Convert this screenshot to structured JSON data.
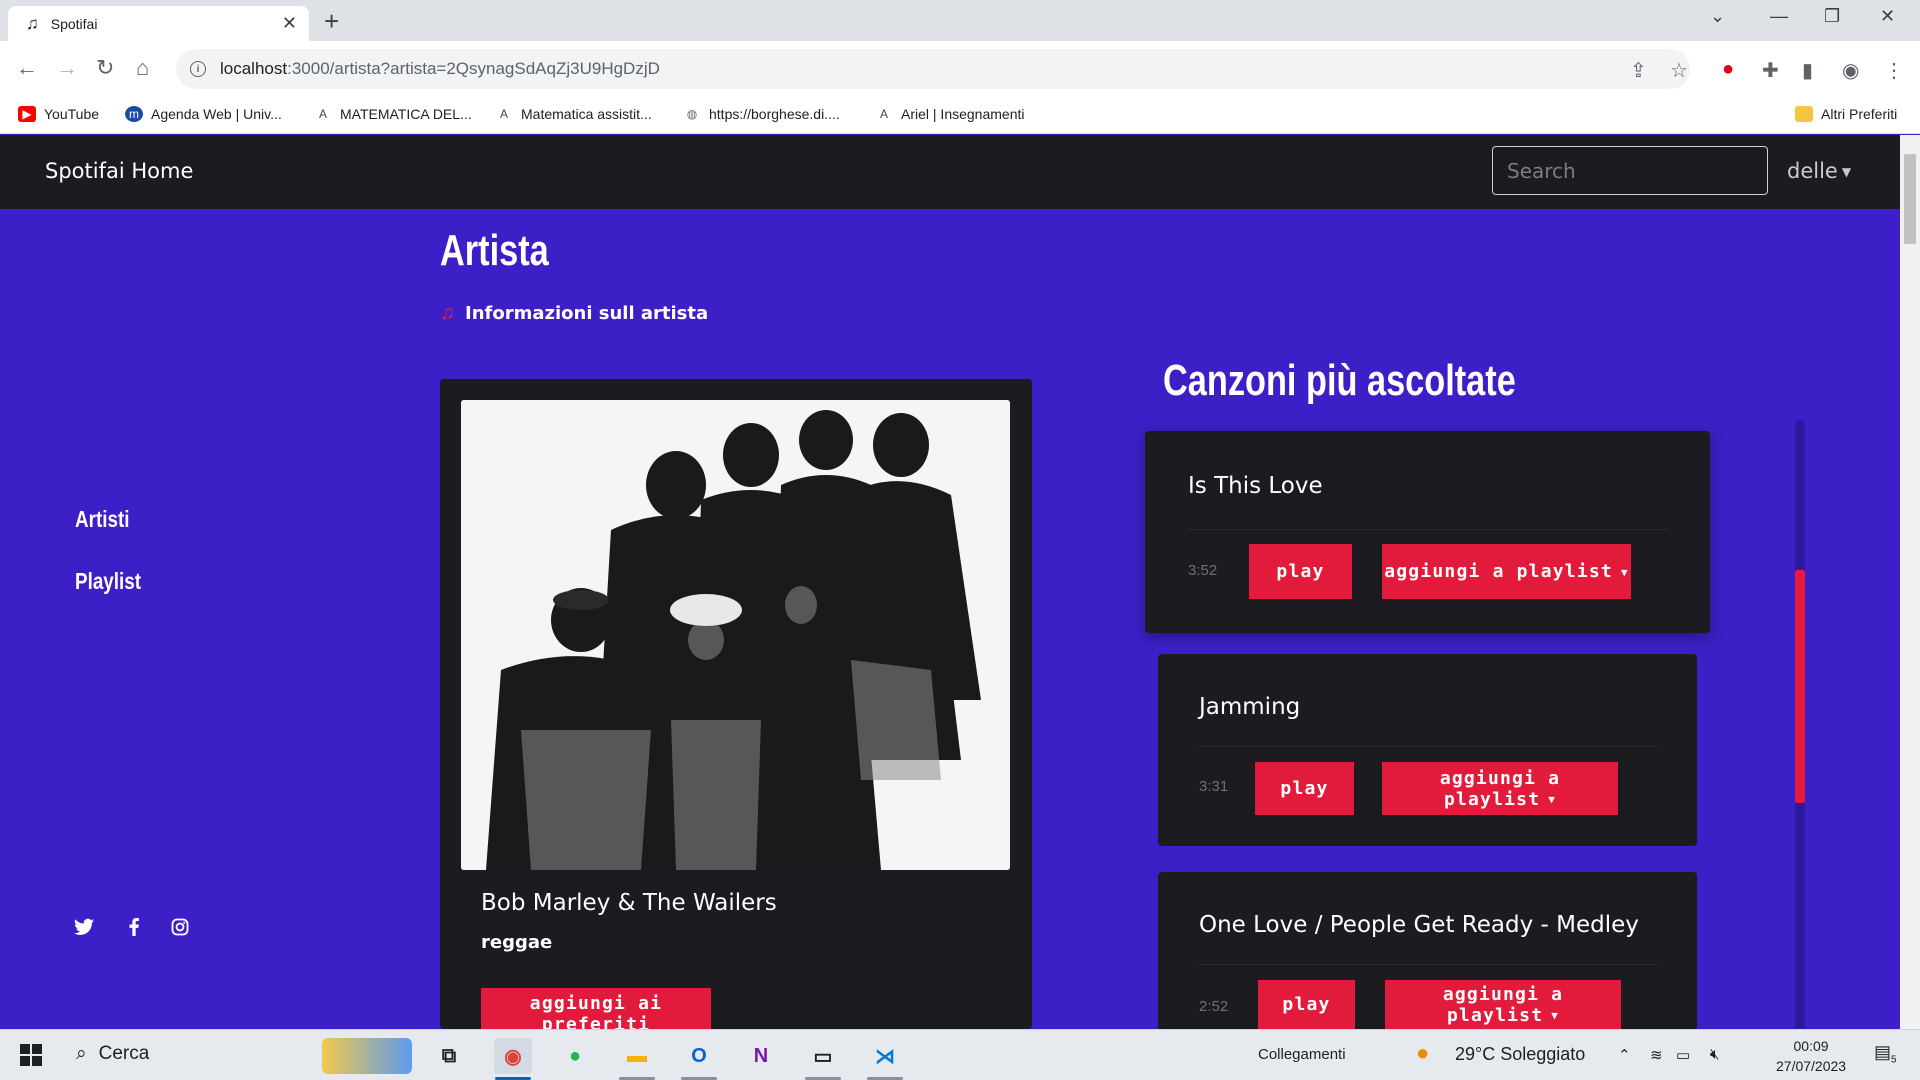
{
  "browser": {
    "tab_title": "Spotifai",
    "url_host": "localhost",
    "url_rest": ":3000/artista?artista=2QsynagSdAqZj3U9HgDzjD",
    "bookmarks": [
      {
        "label": "YouTube",
        "icon": "youtube-icon",
        "color": "#ff0000"
      },
      {
        "label": "Agenda Web | Univ...",
        "icon": "unimi-icon",
        "color": "#1a4aa8"
      },
      {
        "label": "MATEMATICA DEL...",
        "icon": "ariel-icon",
        "color": "#444444"
      },
      {
        "label": "Matematica assistit...",
        "icon": "ariel-icon",
        "color": "#444444"
      },
      {
        "label": "https://borghese.di....",
        "icon": "globe-icon",
        "color": "#5f6368"
      },
      {
        "label": "Ariel | Insegnamenti",
        "icon": "ariel-icon",
        "color": "#444444"
      }
    ],
    "other_bookmarks": "Altri Preferiti"
  },
  "nav": {
    "brand": "Spotifai Home",
    "search_placeholder": "Search",
    "user": "delle"
  },
  "sidebar": {
    "items": [
      {
        "label": "Artisti"
      },
      {
        "label": "Playlist"
      }
    ],
    "social": [
      "twitter-icon",
      "facebook-icon",
      "instagram-icon"
    ]
  },
  "main": {
    "title": "Artista",
    "subtitle": "Informazioni sull artista",
    "artist": {
      "name": "Bob Marley & The Wailers",
      "genre": "reggae",
      "favorite_button": "aggiungi ai preferiti"
    },
    "songs_title": "Canzoni più ascoltate",
    "songs": [
      {
        "title": "Is This Love",
        "duration": "3:52",
        "play": "play",
        "add": "aggiungi a playlist"
      },
      {
        "title": "Jamming",
        "duration": "3:31",
        "play": "play",
        "add": "aggiungi a playlist"
      },
      {
        "title": "One Love / People Get Ready - Medley",
        "duration": "2:52",
        "play": "play",
        "add": "aggiungi a playlist"
      }
    ]
  },
  "colors": {
    "background": "#3d1fc7",
    "card": "#1c1b20",
    "accent": "#e21b3c"
  },
  "taskbar": {
    "search": "Cerca",
    "links": "Collegamenti",
    "weather": "29°C  Soleggiato",
    "time": "00:09",
    "date": "27/07/2023",
    "notifications": "5"
  }
}
